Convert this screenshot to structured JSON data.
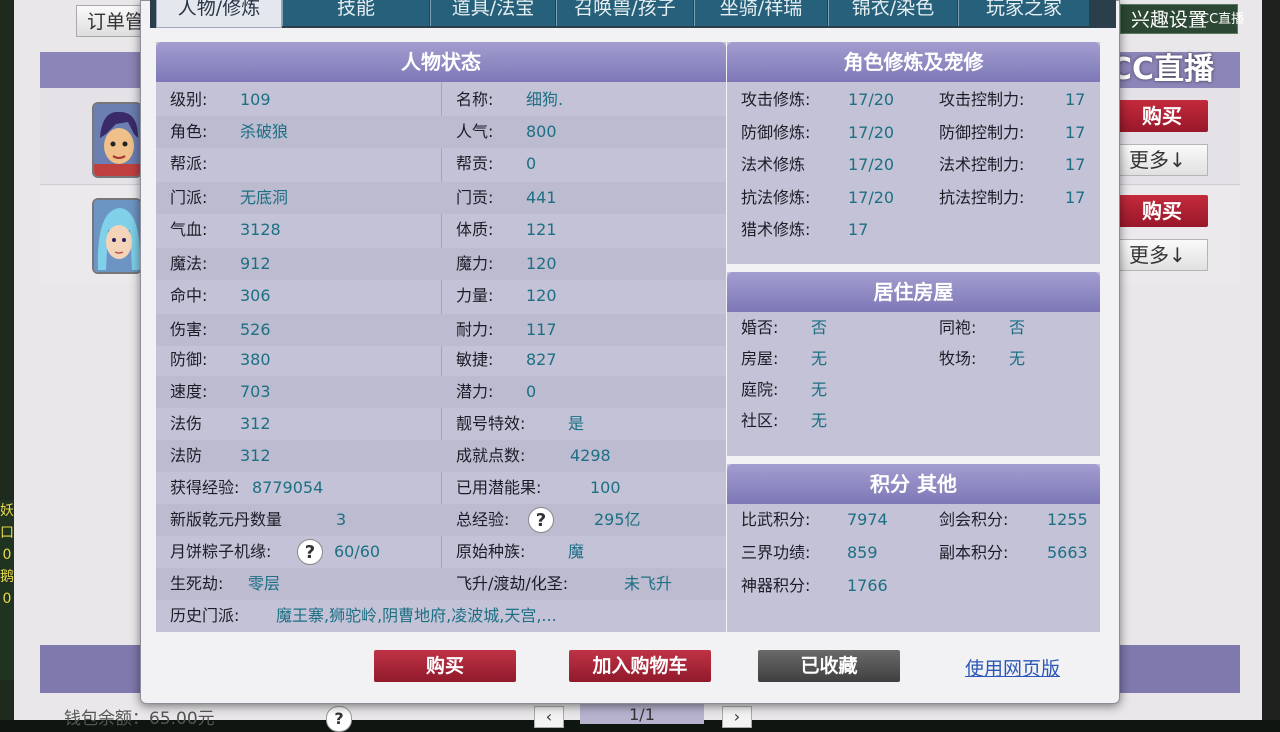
{
  "colors": {
    "accent_red": "#b3243a",
    "value_teal": "#1d6f84",
    "panel_header": "#8e89c3",
    "tab_bg": "#26607a"
  },
  "background": {
    "order_button": "订单管理",
    "interest_button": "兴趣设置",
    "watermark": "CC直播",
    "watermark_small": "CC直播",
    "buy_label": "购买",
    "more_label": "更多↓",
    "wallet_text": "钱包余额：65.00元",
    "help_icon": "?",
    "prev": "‹",
    "page": "1/1",
    "next": "›",
    "left_game_text": "妖 口 0 鹅 0"
  },
  "tabs": [
    {
      "label": "人物/修炼",
      "active": true
    },
    {
      "label": "技能"
    },
    {
      "label": "道具/法宝"
    },
    {
      "label": "召唤兽/孩子"
    },
    {
      "label": "坐骑/祥瑞"
    },
    {
      "label": "锦衣/染色"
    },
    {
      "label": "玩家之家"
    }
  ],
  "status": {
    "title": "人物状态",
    "left": [
      {
        "label": "级别:",
        "value": "109"
      },
      {
        "label": "角色:",
        "value": "杀破狼"
      },
      {
        "label": "帮派:",
        "value": ""
      },
      {
        "label": "门派:",
        "value": "无底洞"
      },
      {
        "label": "气血:",
        "value": "3128"
      },
      {
        "label": "魔法:",
        "value": "912"
      },
      {
        "label": "命中:",
        "value": "306"
      },
      {
        "label": "伤害:",
        "value": "526"
      },
      {
        "label": "防御:",
        "value": "380"
      },
      {
        "label": "速度:",
        "value": "703"
      },
      {
        "label": "法伤",
        "value": "312"
      },
      {
        "label": "法防",
        "value": "312"
      },
      {
        "label": "获得经验:",
        "value": "8779054"
      },
      {
        "label": "新版乾元丹数量",
        "value": "3"
      },
      {
        "label": "月饼粽子机缘:",
        "value": "60/60"
      },
      {
        "label": "生死劫:",
        "value": "零层"
      }
    ],
    "right": [
      {
        "label": "名称:",
        "value": "细狗."
      },
      {
        "label": "人气:",
        "value": "800"
      },
      {
        "label": "帮贡:",
        "value": "0"
      },
      {
        "label": "门贡:",
        "value": "441"
      },
      {
        "label": "体质:",
        "value": "121"
      },
      {
        "label": "魔力:",
        "value": "120"
      },
      {
        "label": "力量:",
        "value": "120"
      },
      {
        "label": "耐力:",
        "value": "117"
      },
      {
        "label": "敏捷:",
        "value": "827"
      },
      {
        "label": "潜力:",
        "value": "0"
      },
      {
        "label": "靓号特效:",
        "value": "是"
      },
      {
        "label": "成就点数:",
        "value": "4298"
      },
      {
        "label": "已用潜能果:",
        "value": "100"
      },
      {
        "label": "总经验:",
        "value": "295亿"
      },
      {
        "label": "原始种族:",
        "value": "魔"
      },
      {
        "label": "飞升/渡劫/化圣:",
        "value": "未飞升"
      }
    ],
    "history_label": "历史门派:",
    "history_value": "魔王寨,狮驼岭,阴曹地府,凌波城,天宫,...",
    "help_icon": "?"
  },
  "cultivation": {
    "title": "角色修炼及宠修",
    "rows": [
      {
        "l1": "攻击修炼:",
        "v1": "17/20",
        "l2": "攻击控制力:",
        "v2": "17"
      },
      {
        "l1": "防御修炼:",
        "v1": "17/20",
        "l2": "防御控制力:",
        "v2": "17"
      },
      {
        "l1": "法术修炼",
        "v1": "17/20",
        "l2": "法术控制力:",
        "v2": "17"
      },
      {
        "l1": "抗法修炼:",
        "v1": "17/20",
        "l2": "抗法控制力:",
        "v2": "17"
      },
      {
        "l1": "猎术修炼:",
        "v1": "17",
        "l2": "",
        "v2": ""
      }
    ]
  },
  "housing": {
    "title": "居住房屋",
    "rows": [
      {
        "l1": "婚否:",
        "v1": "否",
        "l2": "同袍:",
        "v2": "否"
      },
      {
        "l1": "房屋:",
        "v1": "无",
        "l2": "牧场:",
        "v2": "无"
      },
      {
        "l1": "庭院:",
        "v1": "无",
        "l2": "",
        "v2": ""
      },
      {
        "l1": "社区:",
        "v1": "无",
        "l2": "",
        "v2": ""
      }
    ]
  },
  "scores": {
    "title": "积分 其他",
    "rows": [
      {
        "l1": "比武积分:",
        "v1": "7974",
        "l2": "剑会积分:",
        "v2": "1255"
      },
      {
        "l1": "三界功绩:",
        "v1": "859",
        "l2": "副本积分:",
        "v2": "5663"
      },
      {
        "l1": "神器积分:",
        "v1": "1766",
        "l2": "",
        "v2": ""
      }
    ]
  },
  "footer": {
    "buy": "购买",
    "add_cart": "加入购物车",
    "favorited": "已收藏",
    "web_version": "使用网页版"
  }
}
